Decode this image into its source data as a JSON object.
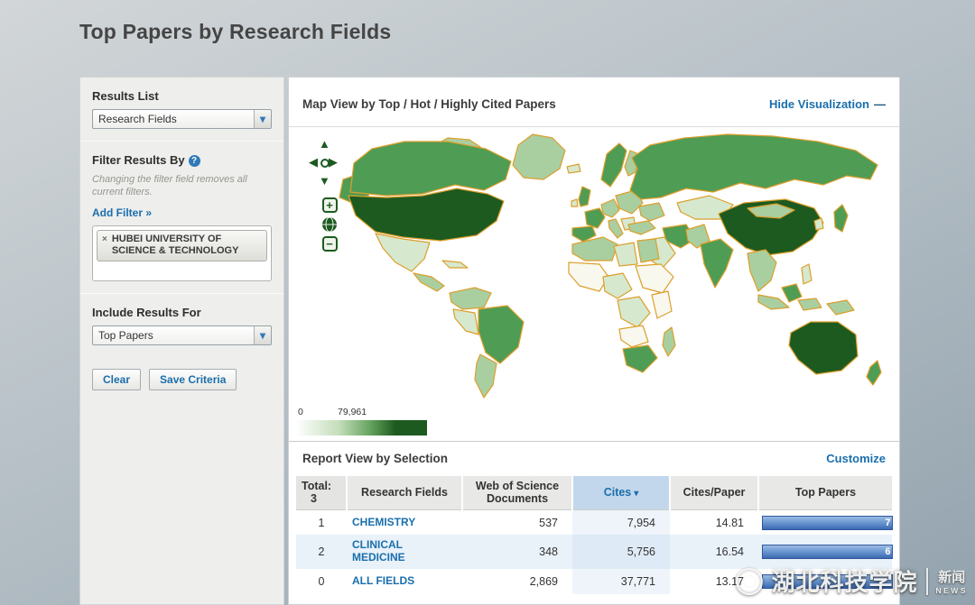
{
  "page": {
    "title": "Top Papers by Research Fields"
  },
  "icons": {
    "chevron_down": "▾",
    "help": "?",
    "remove": "×",
    "hide_minus": "—",
    "sort_desc": "▾",
    "pan_up": "▲",
    "pan_down": "▼",
    "pan_left": "◀",
    "pan_right": "▶",
    "zoom_in": "+",
    "zoom_out": "−"
  },
  "sidebar": {
    "results_list_label": "Results List",
    "results_list_value": "Research Fields",
    "filter_label": "Filter Results By",
    "filter_note": "Changing the filter field removes all current filters.",
    "add_filter_link": "Add Filter »",
    "filter_tag": "HUBEI UNIVERSITY OF SCIENCE & TECHNOLOGY",
    "include_label": "Include Results For",
    "include_value": "Top Papers",
    "clear_button": "Clear",
    "save_button": "Save Criteria"
  },
  "map_panel": {
    "title": "Map View by Top / Hot / Highly Cited Papers",
    "hide_link": "Hide Visualization",
    "legend_min": "0",
    "legend_max": "79,961",
    "colors": {
      "scale_low": "#ffffff",
      "scale_high": "#1d5a20",
      "country_border": "#dd9f2b",
      "link_blue": "#1a6fad"
    }
  },
  "report_panel": {
    "title": "Report View by Selection",
    "customize_link": "Customize",
    "total_label": "Total:",
    "total_value": "3"
  },
  "chart_data": {
    "type": "table",
    "columns": [
      "Research Fields",
      "Web of Science Documents",
      "Cites",
      "Cites/Paper",
      "Top Papers"
    ],
    "sorted_by": "Cites (descending)",
    "rows": [
      {
        "rank": "1",
        "field": "CHEMISTRY",
        "web_of_science_documents": "537",
        "cites": "7,954",
        "cites_per_paper": "14.81",
        "top_papers_bar": "7"
      },
      {
        "rank": "2",
        "field": "CLINICAL MEDICINE",
        "web_of_science_documents": "348",
        "cites": "5,756",
        "cites_per_paper": "16.54",
        "top_papers_bar": "6"
      },
      {
        "rank": "0",
        "field": "ALL FIELDS",
        "web_of_science_documents": "2,869",
        "cites": "37,771",
        "cites_per_paper": "13.17",
        "top_papers_bar": ""
      }
    ]
  },
  "watermark": {
    "org_name": "湖北科技学院",
    "news_cn": "新闻",
    "news_en": "NEWS"
  }
}
